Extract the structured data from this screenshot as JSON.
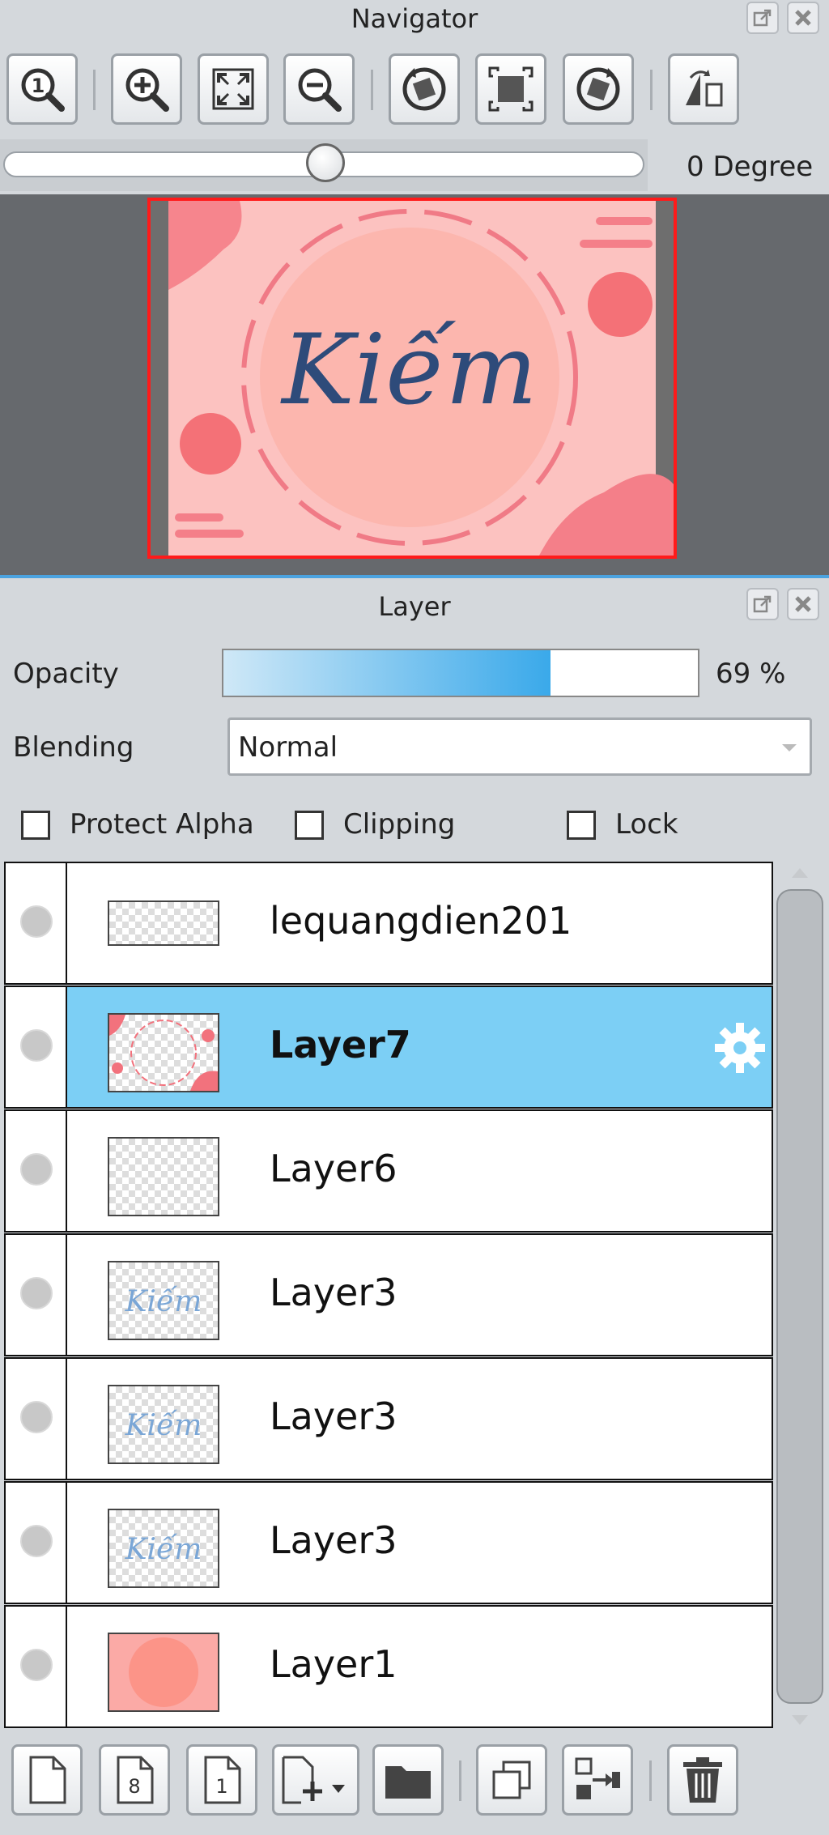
{
  "navigator": {
    "title": "Navigator",
    "rotation_label": "0 Degree",
    "rotation_slider_value": 0.5,
    "toolbar": [
      {
        "icon": "actual-size-icon"
      },
      {
        "icon": "zoom-in-icon"
      },
      {
        "icon": "fit-window-icon"
      },
      {
        "icon": "zoom-out-icon"
      },
      {
        "icon": "rotate-left-icon"
      },
      {
        "icon": "reset-rotation-icon"
      },
      {
        "icon": "rotate-right-icon"
      },
      {
        "icon": "flip-horizontal-icon"
      }
    ],
    "preview": {
      "text": "Kiếm"
    }
  },
  "layer_panel": {
    "title": "Layer",
    "opacity_label": "Opacity",
    "opacity_value": "69 %",
    "opacity_fraction": 0.69,
    "blending_label": "Blending",
    "blending_value": "Normal",
    "protect_alpha_label": "Protect Alpha",
    "clipping_label": "Clipping",
    "lock_label": "Lock",
    "layers": [
      {
        "name": "lequangdien201",
        "selected": false
      },
      {
        "name": "Layer7",
        "selected": true
      },
      {
        "name": "Layer6",
        "selected": false
      },
      {
        "name": "Layer3",
        "selected": false
      },
      {
        "name": "Layer3",
        "selected": false
      },
      {
        "name": "Layer3",
        "selected": false
      },
      {
        "name": "Layer1",
        "selected": false
      }
    ],
    "bottom_toolbar": [
      {
        "icon": "new-layer-icon"
      },
      {
        "icon": "new-8bit-layer-icon",
        "label": "8"
      },
      {
        "icon": "new-1bit-layer-icon",
        "label": "1"
      },
      {
        "icon": "add-layer-dropdown-icon"
      },
      {
        "icon": "new-folder-icon"
      },
      {
        "icon": "duplicate-layer-icon"
      },
      {
        "icon": "transfer-down-icon"
      },
      {
        "icon": "delete-layer-icon"
      }
    ]
  },
  "colors": {
    "selection": "#7ccff5",
    "panel_bg": "#d4d8dc",
    "preview_bg": "#66696d",
    "canvas_pink": "#fcc2c0",
    "accent_red": "#ff0000"
  }
}
